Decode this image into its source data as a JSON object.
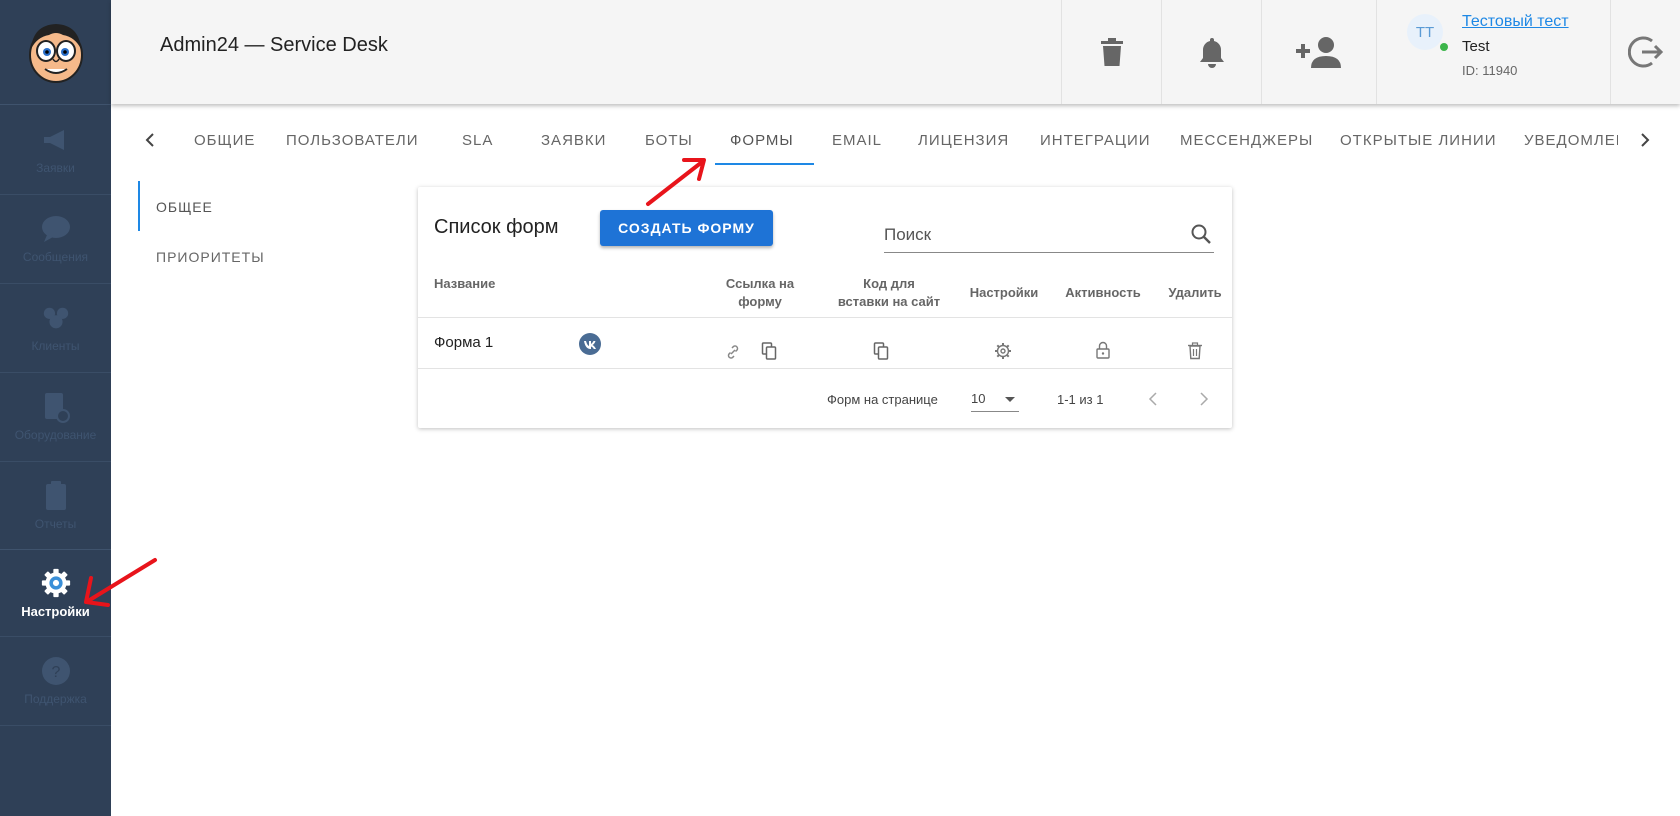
{
  "sidebar": {
    "items": [
      {
        "label": "Заявки",
        "icon": "megaphone-icon"
      },
      {
        "label": "Сообщения",
        "icon": "chat-icon"
      },
      {
        "label": "Клиенты",
        "icon": "clients-icon"
      },
      {
        "label": "Оборудование",
        "icon": "equipment-icon"
      },
      {
        "label": "Отчеты",
        "icon": "report-icon"
      },
      {
        "label": "Настройки",
        "icon": "gear-icon"
      },
      {
        "label": "Поддержка",
        "icon": "help-icon"
      }
    ]
  },
  "header": {
    "title": "Admin24 — Service Desk",
    "user": {
      "initials": "TT",
      "name": "Тестовый тест",
      "subtitle": "Test",
      "id_text": "ID: 11940"
    }
  },
  "tabs": [
    "ОБЩИЕ",
    "ПОЛЬЗОВАТЕЛИ",
    "SLA",
    "ЗАЯВКИ",
    "БОТЫ",
    "ФОРМЫ",
    "EMAIL",
    "ЛИЦЕНЗИЯ",
    "ИНТЕГРАЦИИ",
    "МЕССЕНДЖЕРЫ",
    "ОТКРЫТЫЕ ЛИНИИ",
    "УВЕДОМЛЕН"
  ],
  "active_tab": "ФОРМЫ",
  "subnav": [
    "ОБЩЕЕ",
    "ПРИОРИТЕТЫ"
  ],
  "forms_card": {
    "title": "Список форм",
    "create_button": "СОЗДАТЬ ФОРМУ",
    "search_placeholder": "Поиск",
    "columns": {
      "name": "Название",
      "link_1": "Ссылка на",
      "link_2": "форму",
      "code_1": "Код для",
      "code_2": "вставки на сайт",
      "settings": "Настройки",
      "activity": "Активность",
      "delete": "Удалить"
    },
    "rows": [
      {
        "name": "Форма 1",
        "channel": "vk"
      }
    ],
    "footer": {
      "per_page_label": "Форм на странице",
      "per_page_value": "10",
      "range": "1-1 из 1"
    }
  },
  "colors": {
    "sidebar": "#2f4057",
    "accent": "#1e88e5",
    "button": "#1e73d6",
    "annotation": "#e8141b"
  }
}
